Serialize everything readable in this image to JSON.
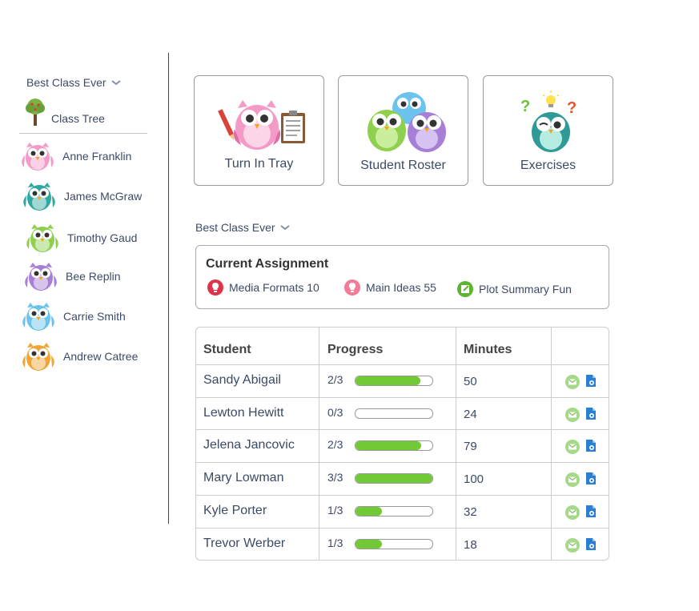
{
  "sidebar": {
    "class_name": "Best Class Ever",
    "tree_label": "Class Tree",
    "students": [
      {
        "name": "Anne Franklin",
        "owl": "pink-owl-icon",
        "color": "#f39ac8"
      },
      {
        "name": "James McGraw",
        "owl": "teal-owl-icon",
        "color": "#2fa8a0"
      },
      {
        "name": "Timothy Gaud",
        "owl": "green-owl-icon",
        "color": "#8fd14f"
      },
      {
        "name": "Bee Replin",
        "owl": "purple-owl-icon",
        "color": "#a77fd6"
      },
      {
        "name": "Carrie Smith",
        "owl": "blue-owl-icon",
        "color": "#6cc3ee"
      },
      {
        "name": "Andrew Catree",
        "owl": "orange-owl-icon",
        "color": "#f0a536"
      }
    ]
  },
  "tiles": {
    "turn_in": "Turn In Tray",
    "roster": "Student Roster",
    "exercises": "Exercises"
  },
  "main": {
    "class_name": "Best Class Ever",
    "assignment": {
      "title": "Current Assignment",
      "items": [
        {
          "label": "Media Formats 10",
          "icon": "red-lightbulb-icon"
        },
        {
          "label": "Main Ideas 55",
          "icon": "pink-lightbulb-icon"
        },
        {
          "label": "Plot Summary Fun",
          "icon": "green-pencil-icon"
        }
      ]
    },
    "table": {
      "headers": [
        "Student",
        "Progress",
        "Minutes",
        ""
      ],
      "rows": [
        {
          "student": "Sandy Abigail",
          "progress": "2/3",
          "progress_value": 0.84,
          "minutes": "50"
        },
        {
          "student": "Lewton Hewitt",
          "progress": "0/3",
          "progress_value": 0.0,
          "minutes": "24"
        },
        {
          "student": "Jelena Jancovic",
          "progress": "2/3",
          "progress_value": 0.85,
          "minutes": "79"
        },
        {
          "student": "Mary Lowman",
          "progress": "3/3",
          "progress_value": 1.0,
          "minutes": "100"
        },
        {
          "student": "Kyle Porter",
          "progress": "1/3",
          "progress_value": 0.34,
          "minutes": "32"
        },
        {
          "student": "Trevor Werber",
          "progress": "1/3",
          "progress_value": 0.34,
          "minutes": "18"
        }
      ]
    }
  },
  "colors": {
    "accent_green": "#71c936",
    "text_blue": "#3c4a66",
    "icon_blue": "#2a7fd4"
  }
}
